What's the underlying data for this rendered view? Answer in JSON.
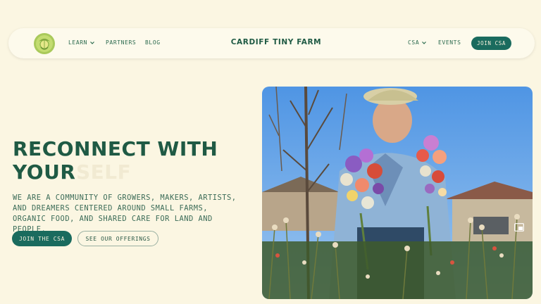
{
  "nav": {
    "links_left": [
      {
        "label": "LEARN",
        "has_dropdown": true
      },
      {
        "label": "PARTNERS",
        "has_dropdown": false
      },
      {
        "label": "BLOG",
        "has_dropdown": false
      }
    ],
    "brand": "CARDIFF TINY FARM",
    "links_right": [
      {
        "label": "CSA",
        "has_dropdown": true
      },
      {
        "label": "EVENTS",
        "has_dropdown": false
      }
    ],
    "join_label": "JOIN CSA"
  },
  "hero": {
    "headline_line1": "RECONNECT WITH",
    "headline_line2": "YOUR",
    "headline_ghost": "SELF",
    "description": "WE ARE A COMMUNITY OF GROWERS, MAKERS, ARTISTS, AND DREAMERS CENTERED AROUND SMALL FARMS, ORGANIC FOOD, AND SHARED CARE FOR LAND AND PEOPLE.",
    "cta_primary": "JOIN THE CSA",
    "cta_secondary": "SEE OUR OFFERINGS"
  },
  "media": {
    "pip_icon": "picture-in-picture-icon"
  },
  "colors": {
    "background": "#fbf6e2",
    "brand_green": "#1f5a44",
    "button_teal": "#1a6b5e"
  }
}
